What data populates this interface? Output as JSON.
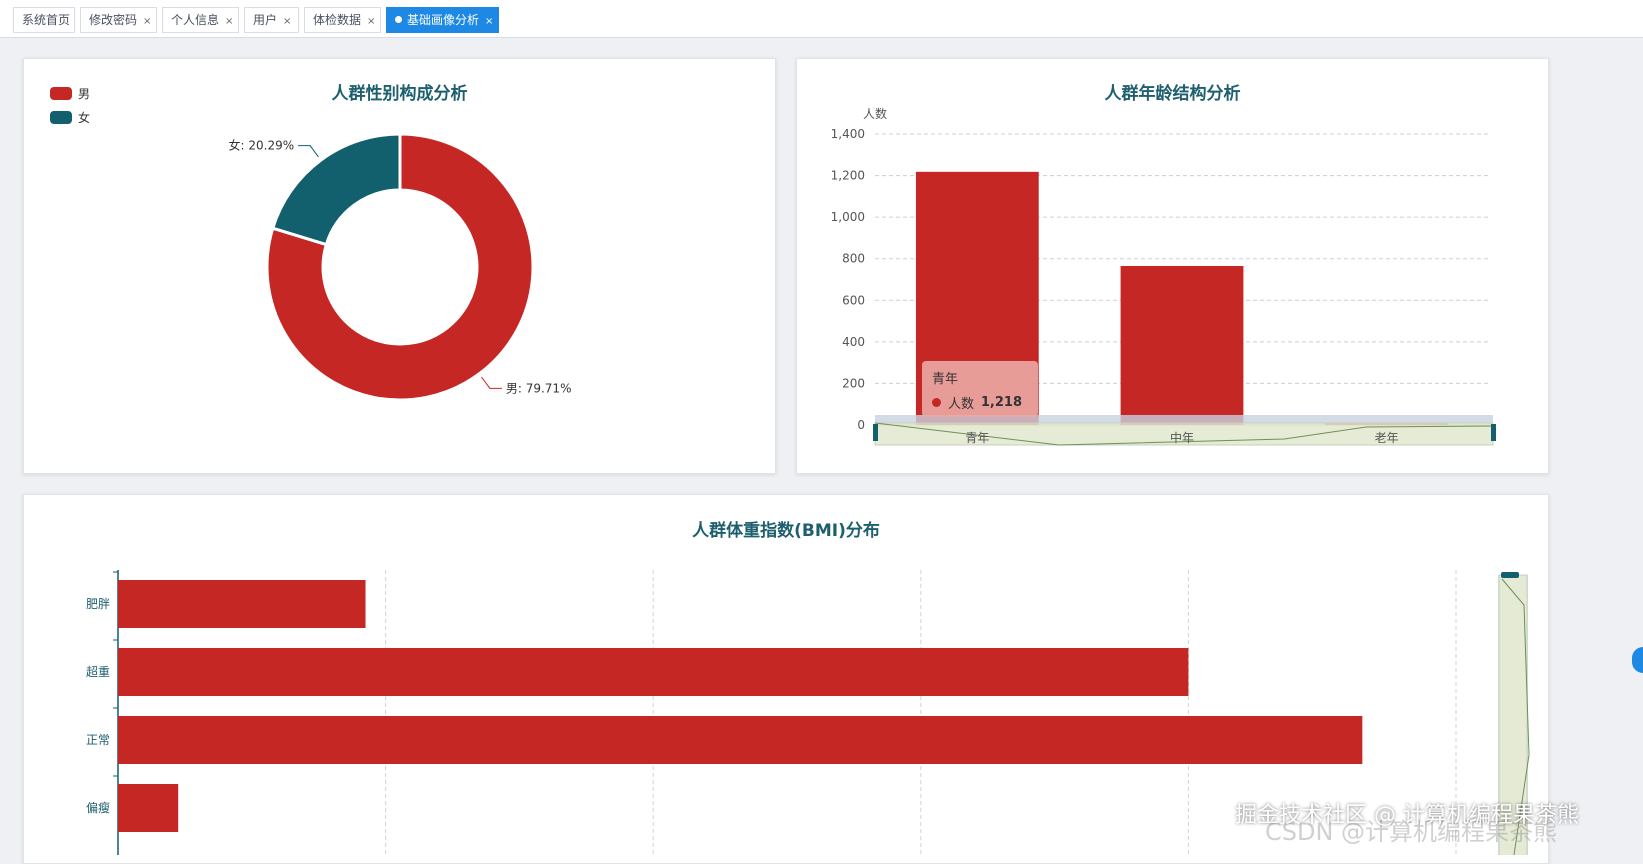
{
  "tabs": [
    {
      "label": "系统首页",
      "closable": false,
      "active": false
    },
    {
      "label": "修改密码",
      "closable": true,
      "active": false
    },
    {
      "label": "个人信息",
      "closable": true,
      "active": false
    },
    {
      "label": "用户",
      "closable": true,
      "active": false
    },
    {
      "label": "体检数据",
      "closable": true,
      "active": false
    },
    {
      "label": "基础画像分析",
      "closable": true,
      "active": true
    }
  ],
  "close_glyph": "×",
  "colors": {
    "red": "#c42724",
    "teal": "#125f6e",
    "title": "#1d5f6e",
    "accent": "#1e88e5"
  },
  "gender_panel": {
    "title": "人群性别构成分析",
    "legend": [
      {
        "label": "男",
        "color": "#c42724"
      },
      {
        "label": "女",
        "color": "#125f6e"
      }
    ]
  },
  "age_panel": {
    "title": "人群年龄结构分析",
    "tooltip": {
      "category": "青年",
      "series": "人数",
      "value": "1,218"
    }
  },
  "bmi_panel": {
    "title": "人群体重指数(BMI)分布"
  },
  "chart_data": [
    {
      "type": "pie",
      "title": "人群性别构成分析",
      "donut": true,
      "legend_position": "top-left",
      "slices": [
        {
          "name": "男",
          "value": 79.71,
          "label": "男: 79.71%",
          "color": "#c42724"
        },
        {
          "name": "女",
          "value": 20.29,
          "label": "女: 20.29%",
          "color": "#125f6e"
        }
      ]
    },
    {
      "type": "bar",
      "title": "人群年龄结构分析",
      "ylabel": "人数",
      "categories": [
        "青年",
        "中年",
        "老年"
      ],
      "values": [
        1218,
        765,
        10
      ],
      "ylim": [
        0,
        1400
      ],
      "yticks": [
        0,
        200,
        400,
        600,
        800,
        1000,
        1200,
        1400
      ],
      "ytick_labels": [
        "0",
        "200",
        "400",
        "600",
        "800",
        "1,000",
        "1,200",
        "1,400"
      ],
      "grid": true,
      "datazoom": "bottom"
    },
    {
      "type": "bar",
      "orientation": "horizontal",
      "title": "人群体重指数(BMI)分布",
      "categories": [
        "肥胖",
        "超重",
        "正常",
        "偏瘦"
      ],
      "values": [
        185,
        800,
        930,
        45
      ],
      "xlim": [
        0,
        1000
      ],
      "grid": true,
      "datazoom": "right"
    }
  ],
  "watermark": "掘金技术社区 @ 计算机编程果茶熊",
  "watermark_faint": "CSDN @计算机编程果茶熊"
}
